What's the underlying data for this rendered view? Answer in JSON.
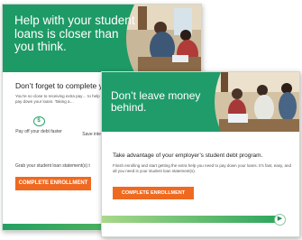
{
  "back_card": {
    "hero_title": "Help with your student loans is closer than you think.",
    "heading": "Don’t forget to complete yo",
    "body": "You’re so close to receiving extra pay… to help pay down your loans. Taking a…",
    "benefits": [
      {
        "icon": "dollar-circle-icon",
        "label": "Pay off your debt faster"
      },
      {
        "icon": "savings-icon",
        "label": "Save inter…"
      }
    ],
    "note": "Grab your student loan statement(s) t",
    "button_label": "COMPLETE ENROLLMENT",
    "colors": {
      "hero": "#1e9a66",
      "button": "#ef6a20"
    }
  },
  "front_card": {
    "hero_title": "Don’t leave money behind.",
    "heading": "Take advantage of your employer’s student debt program.",
    "body": "Finish enrolling and start getting the extra help you need to pay down your loans. It’s fast, easy, and all you need is your student loan statement(s).",
    "button_label": "COMPLETE ENROLLMENT",
    "next_icon": "play-circle-icon",
    "colors": {
      "hero": "#1f9c6a",
      "button": "#ef6a20"
    }
  }
}
